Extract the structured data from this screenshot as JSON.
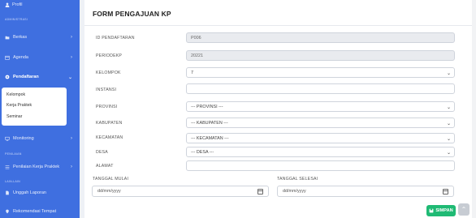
{
  "sidebar": {
    "profile_label": "Profil",
    "section_admin": "ADMINISTRASI",
    "berkas": "Berkas",
    "agenda": "Agenda",
    "pendaftaran": "Pendaftaran",
    "sub_kelompok": "Kelompok",
    "sub_kerja_praktek": "Kerja Praktek",
    "sub_seminar": "Seminar",
    "monitoring": "Monitoring",
    "section_penilaian": "PENILAIAN",
    "penilaian_kp": "Penilaian Kerja Praktek",
    "section_lain": "LAIN-LAIN",
    "unggah_laporan": "Unggah Laporan",
    "rekomendasi": "Rekomendasi Tempat"
  },
  "form": {
    "title": "FORM PENGAJUAN KP",
    "id_label": "ID PENDAFTARAN",
    "id_value": "P006",
    "periode_label": "PERIODEKP",
    "periode_value": "20221",
    "kelompok_label": "KELOMPOK",
    "kelompok_value": "7",
    "instansi_label": "INSTANSI",
    "instansi_value": "",
    "provinsi_label": "PROVINSI",
    "provinsi_value": "--- PROVINSI ---",
    "kabupaten_label": "KABUPATEN",
    "kabupaten_value": "--- KABUPATEN ---",
    "kecamatan_label": "KECAMATAN",
    "kecamatan_value": "--- KECAMATAN ---",
    "desa_label": "DESA",
    "desa_value": "--- DESA ---",
    "alamat_label": "ALAMAT",
    "alamat_value": "",
    "tgl_mulai_label": "TANGGAL MULAI",
    "tgl_mulai_placeholder": "dd/mm/yyyy",
    "tgl_selesai_label": "TANGGAL SELESAI",
    "tgl_selesai_placeholder": "dd/mm/yyyy",
    "save_label": "SIMPAN"
  }
}
